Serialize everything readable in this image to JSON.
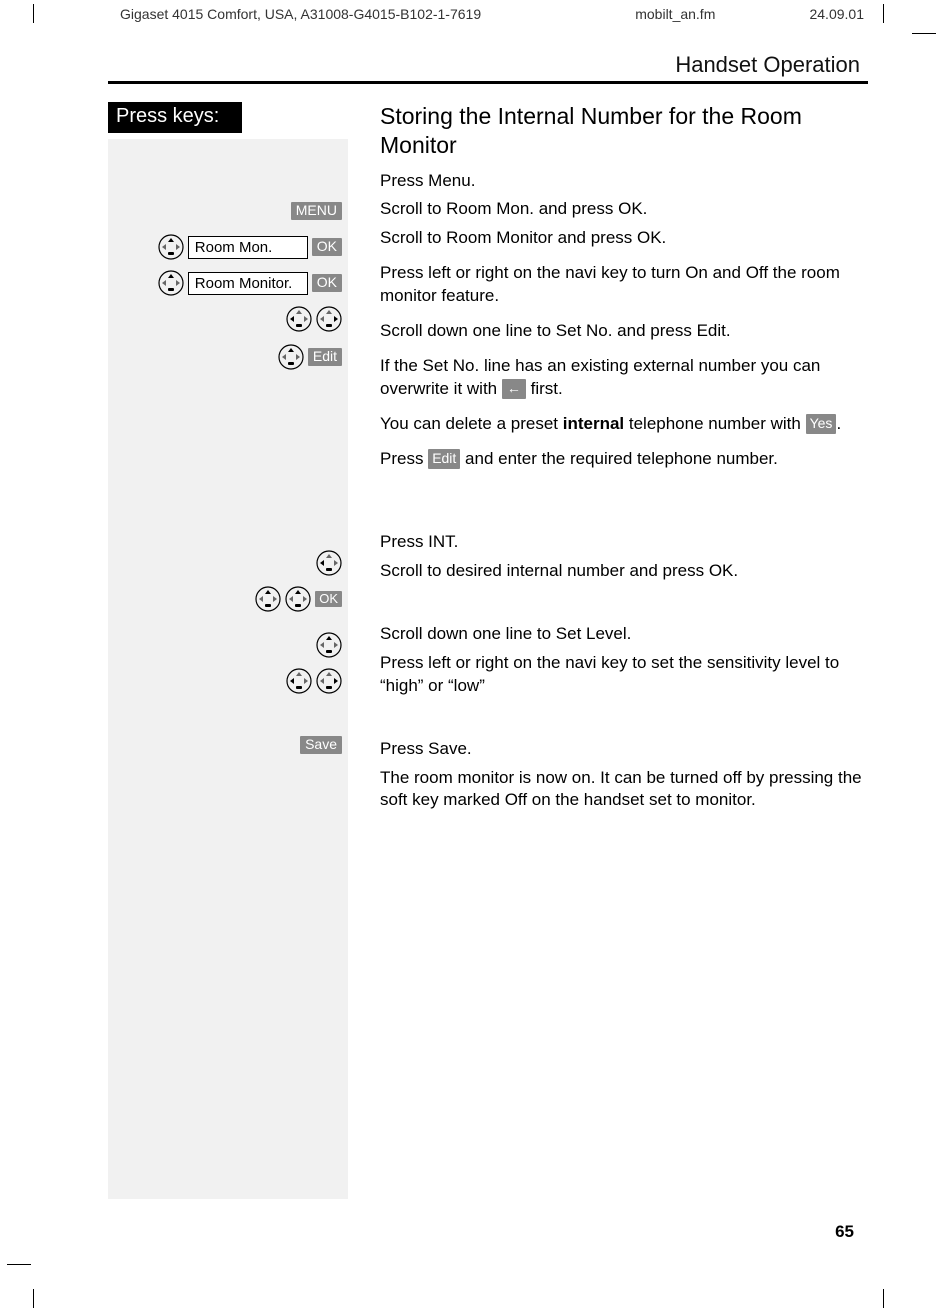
{
  "header": {
    "doc_id": "Gigaset 4015 Comfort, USA, A31008-G4015-B102-1-7619",
    "filename": "mobilt_an.fm",
    "date": "24.09.01"
  },
  "section_title": "Handset Operation",
  "press_keys_label": "Press keys:",
  "title": "Storing the Internal Number for the Room Monitor",
  "labels": {
    "menu": "MENU",
    "ok": "OK",
    "edit": "Edit",
    "save": "Save",
    "yes": "Yes"
  },
  "left": {
    "room_mon": "Room Mon.",
    "room_monitor": "Room Monitor."
  },
  "steps": {
    "s1": "Press Menu.",
    "s2": "Scroll to Room Mon. and press OK.",
    "s3": "Scroll to Room Monitor and press OK.",
    "s4": "Press left or right on the navi key to turn On and Off the room monitor feature.",
    "s5": "Scroll down one line to Set No. and press Edit.",
    "s6a": "If the Set No. line has an existing external number you can overwrite it with ",
    "s6b": " first.",
    "s7a": "You can delete a preset ",
    "s7b": "internal",
    "s7c": " telephone number with ",
    "s7d": ".",
    "s8a": "Press ",
    "s8b": " and enter the required telephone number.",
    "s9": "Press INT.",
    "s10": "Scroll to desired internal number and press OK.",
    "s11": "Scroll down one line to Set Level.",
    "s12": "Press left or right on the navi key to set the sensitivity level to “high” or “low”",
    "s13": "Press Save.",
    "s14": "The room monitor is now on.  It can be turned off by pressing the soft key marked Off on the handset set to monitor."
  },
  "page_number": "65"
}
